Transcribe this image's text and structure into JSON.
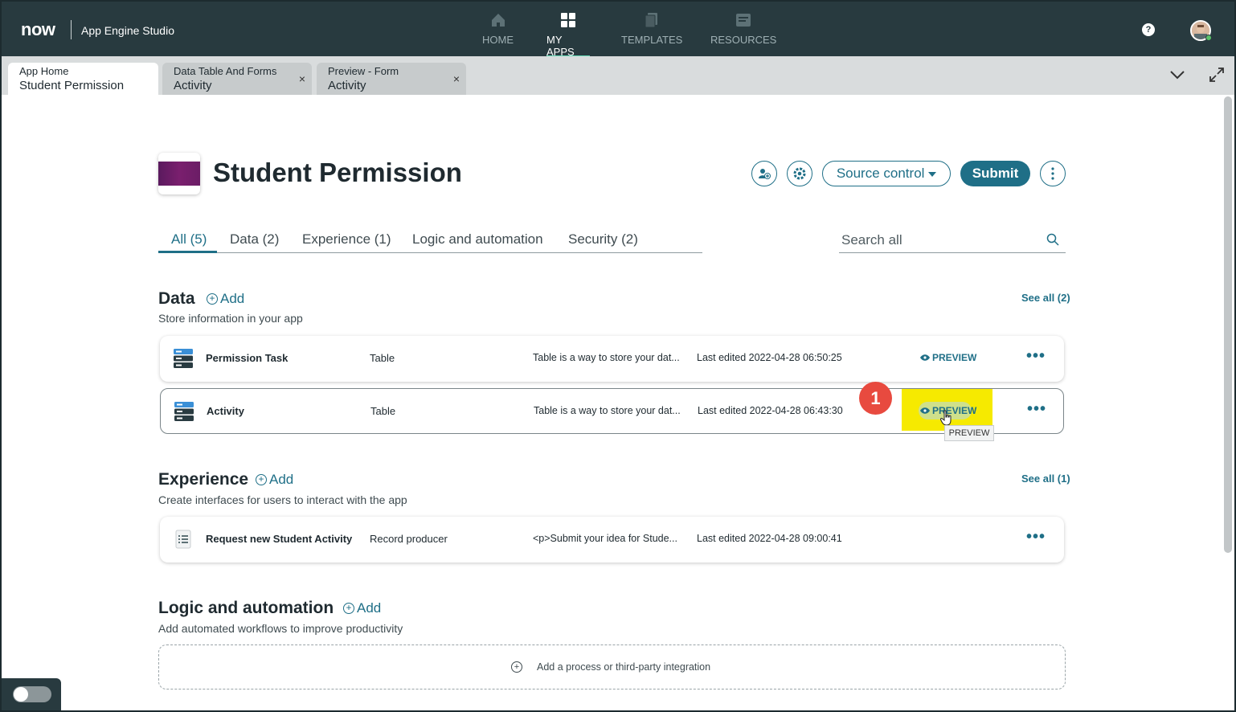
{
  "topbar": {
    "logo": "now",
    "app_name": "App Engine Studio",
    "nav": [
      {
        "label": "HOME",
        "icon": "home-icon"
      },
      {
        "label": "MY APPS",
        "icon": "grid-icon",
        "active": true
      },
      {
        "label": "TEMPLATES",
        "icon": "templates-icon"
      },
      {
        "label": "RESOURCES",
        "icon": "resources-icon"
      }
    ],
    "help": "?"
  },
  "tabs": [
    {
      "line1": "App Home",
      "line2": "Student Permission",
      "active": true
    },
    {
      "line1": "Data Table And Forms",
      "line2": "Activity",
      "close": "×"
    },
    {
      "line1": "Preview - Form",
      "line2": "Activity",
      "close": "×"
    }
  ],
  "header": {
    "title": "Student Permission",
    "source_control": "Source control",
    "submit": "Submit"
  },
  "filter_tabs": [
    {
      "label": "All (5)",
      "active": true
    },
    {
      "label": "Data (2)"
    },
    {
      "label": "Experience (1)"
    },
    {
      "label": "Logic and automation"
    },
    {
      "label": "Security (2)"
    }
  ],
  "search": {
    "placeholder": "Search all"
  },
  "data_section": {
    "title": "Data",
    "add": "Add",
    "desc": "Store information in your app",
    "see_all": "See all (2)",
    "rows": [
      {
        "name": "Permission Task",
        "type": "Table",
        "desc": "Table is a way to store your dat...",
        "edited": "Last edited 2022-04-28 06:50:25",
        "preview": "PREVIEW"
      },
      {
        "name": "Activity",
        "type": "Table",
        "desc": "Table is a way to store your dat...",
        "edited": "Last edited 2022-04-28 06:43:30",
        "preview": "PREVIEW"
      }
    ]
  },
  "experience_section": {
    "title": "Experience",
    "add": "Add",
    "desc": "Create interfaces for users to interact with the app",
    "see_all": "See all (1)",
    "rows": [
      {
        "name": "Request new Student Activity",
        "type": "Record producer",
        "desc": "<p>Submit your idea for Stude...",
        "edited": "Last edited 2022-04-28 09:00:41"
      }
    ]
  },
  "logic_section": {
    "title": "Logic and automation",
    "add": "Add",
    "desc": "Add automated workflows to improve productivity",
    "placeholder": "Add a process or third-party integration"
  },
  "annotation": {
    "step": "1",
    "tooltip": "PREVIEW"
  },
  "colors": {
    "accent": "#1f6f87",
    "topbar": "#283a3f",
    "highlight": "#f6ea00",
    "badge": "#e84a3f"
  }
}
